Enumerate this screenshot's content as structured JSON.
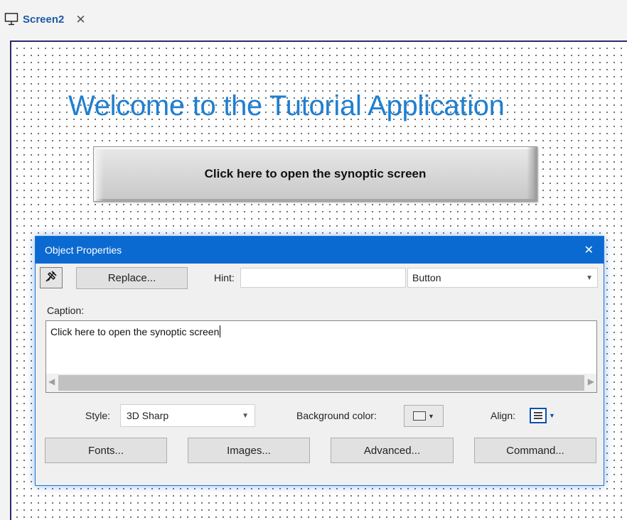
{
  "tab": {
    "title": "Screen2",
    "close_glyph": "✕",
    "icon": "monitor-icon"
  },
  "canvas": {
    "welcome_text": "Welcome to the Tutorial Application",
    "open_button_label": "Click here to open the synoptic screen",
    "welcome_color": "#1f7fd1"
  },
  "dialog": {
    "title": "Object Properties",
    "close_glyph": "✕",
    "titlebar_color": "#0b6ad1",
    "pin_icon": "pin-icon",
    "replace_label": "Replace...",
    "hint_label": "Hint:",
    "hint_value": "",
    "object_type": "Button",
    "caption_label": "Caption:",
    "caption_value": "Click here to open the synoptic screen",
    "style_label": "Style:",
    "style_value": "3D Sharp",
    "background_color_label": "Background color:",
    "align_label": "Align:",
    "fonts_label": "Fonts...",
    "images_label": "Images...",
    "advanced_label": "Advanced...",
    "command_label": "Command..."
  }
}
